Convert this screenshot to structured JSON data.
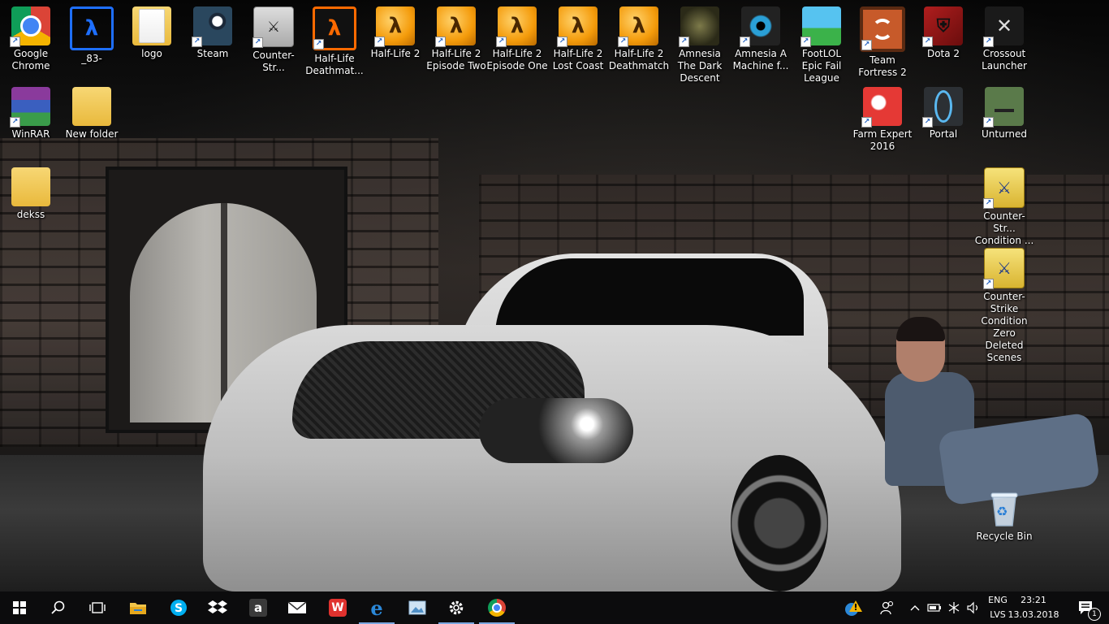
{
  "desktop": {
    "icons": [
      {
        "label": "Google Chrome"
      },
      {
        "label": "_83-"
      },
      {
        "label": "logo"
      },
      {
        "label": "Steam"
      },
      {
        "label": "Counter-Str..."
      },
      {
        "label": "Half-Life Deathmat..."
      },
      {
        "label": "Half-Life 2"
      },
      {
        "label": "Half-Life 2 Episode Two"
      },
      {
        "label": "Half-Life 2 Episode One"
      },
      {
        "label": "Half-Life 2 Lost Coast"
      },
      {
        "label": "Half-Life 2 Deathmatch"
      },
      {
        "label": "Amnesia The Dark Descent"
      },
      {
        "label": "Amnesia A Machine f..."
      },
      {
        "label": "FootLOL Epic Fail League"
      },
      {
        "label": "Team Fortress 2"
      },
      {
        "label": "Dota 2"
      },
      {
        "label": "Crossout Launcher"
      },
      {
        "label": "WinRAR"
      },
      {
        "label": "New folder"
      },
      {
        "label": "dekss"
      },
      {
        "label": "Farm Expert 2016"
      },
      {
        "label": "Portal"
      },
      {
        "label": "Unturned"
      },
      {
        "label": "Counter-Str... Condition ..."
      },
      {
        "label": "Counter-Strike Condition Zero Deleted Scenes"
      },
      {
        "label": "Recycle Bin"
      }
    ]
  },
  "icon_glyphs": {
    "half_life": "λ",
    "counter_strike": "⚔",
    "dota": "⛨",
    "crossout": "✕",
    "recycle": "♻",
    "shortcut_arrow": "↗"
  },
  "taskbar": {
    "apps": [
      {
        "name": "start-button-icon"
      },
      {
        "name": "search-icon"
      },
      {
        "name": "task-view-icon"
      },
      {
        "name": "file-explorer-icon"
      },
      {
        "name": "skype-icon"
      },
      {
        "name": "dropbox-icon"
      },
      {
        "name": "amazon-icon"
      },
      {
        "name": "mail-icon"
      },
      {
        "name": "wps-office-icon"
      },
      {
        "name": "edge-icon"
      },
      {
        "name": "photo-viewer-icon"
      },
      {
        "name": "settings-gear-icon"
      },
      {
        "name": "chrome-icon"
      }
    ],
    "amazon_glyph": "a",
    "wps_glyph": "W",
    "edge_glyph": "e",
    "tray": {
      "language_top": "ENG",
      "language_bottom": "LVS",
      "time": "23:21",
      "date": "13.03.2018",
      "notification_count": "1"
    }
  },
  "colors": {
    "taskbar_bg": "#0c0c0e",
    "accent": "#7aa7e0",
    "warning": "#f4b400"
  }
}
